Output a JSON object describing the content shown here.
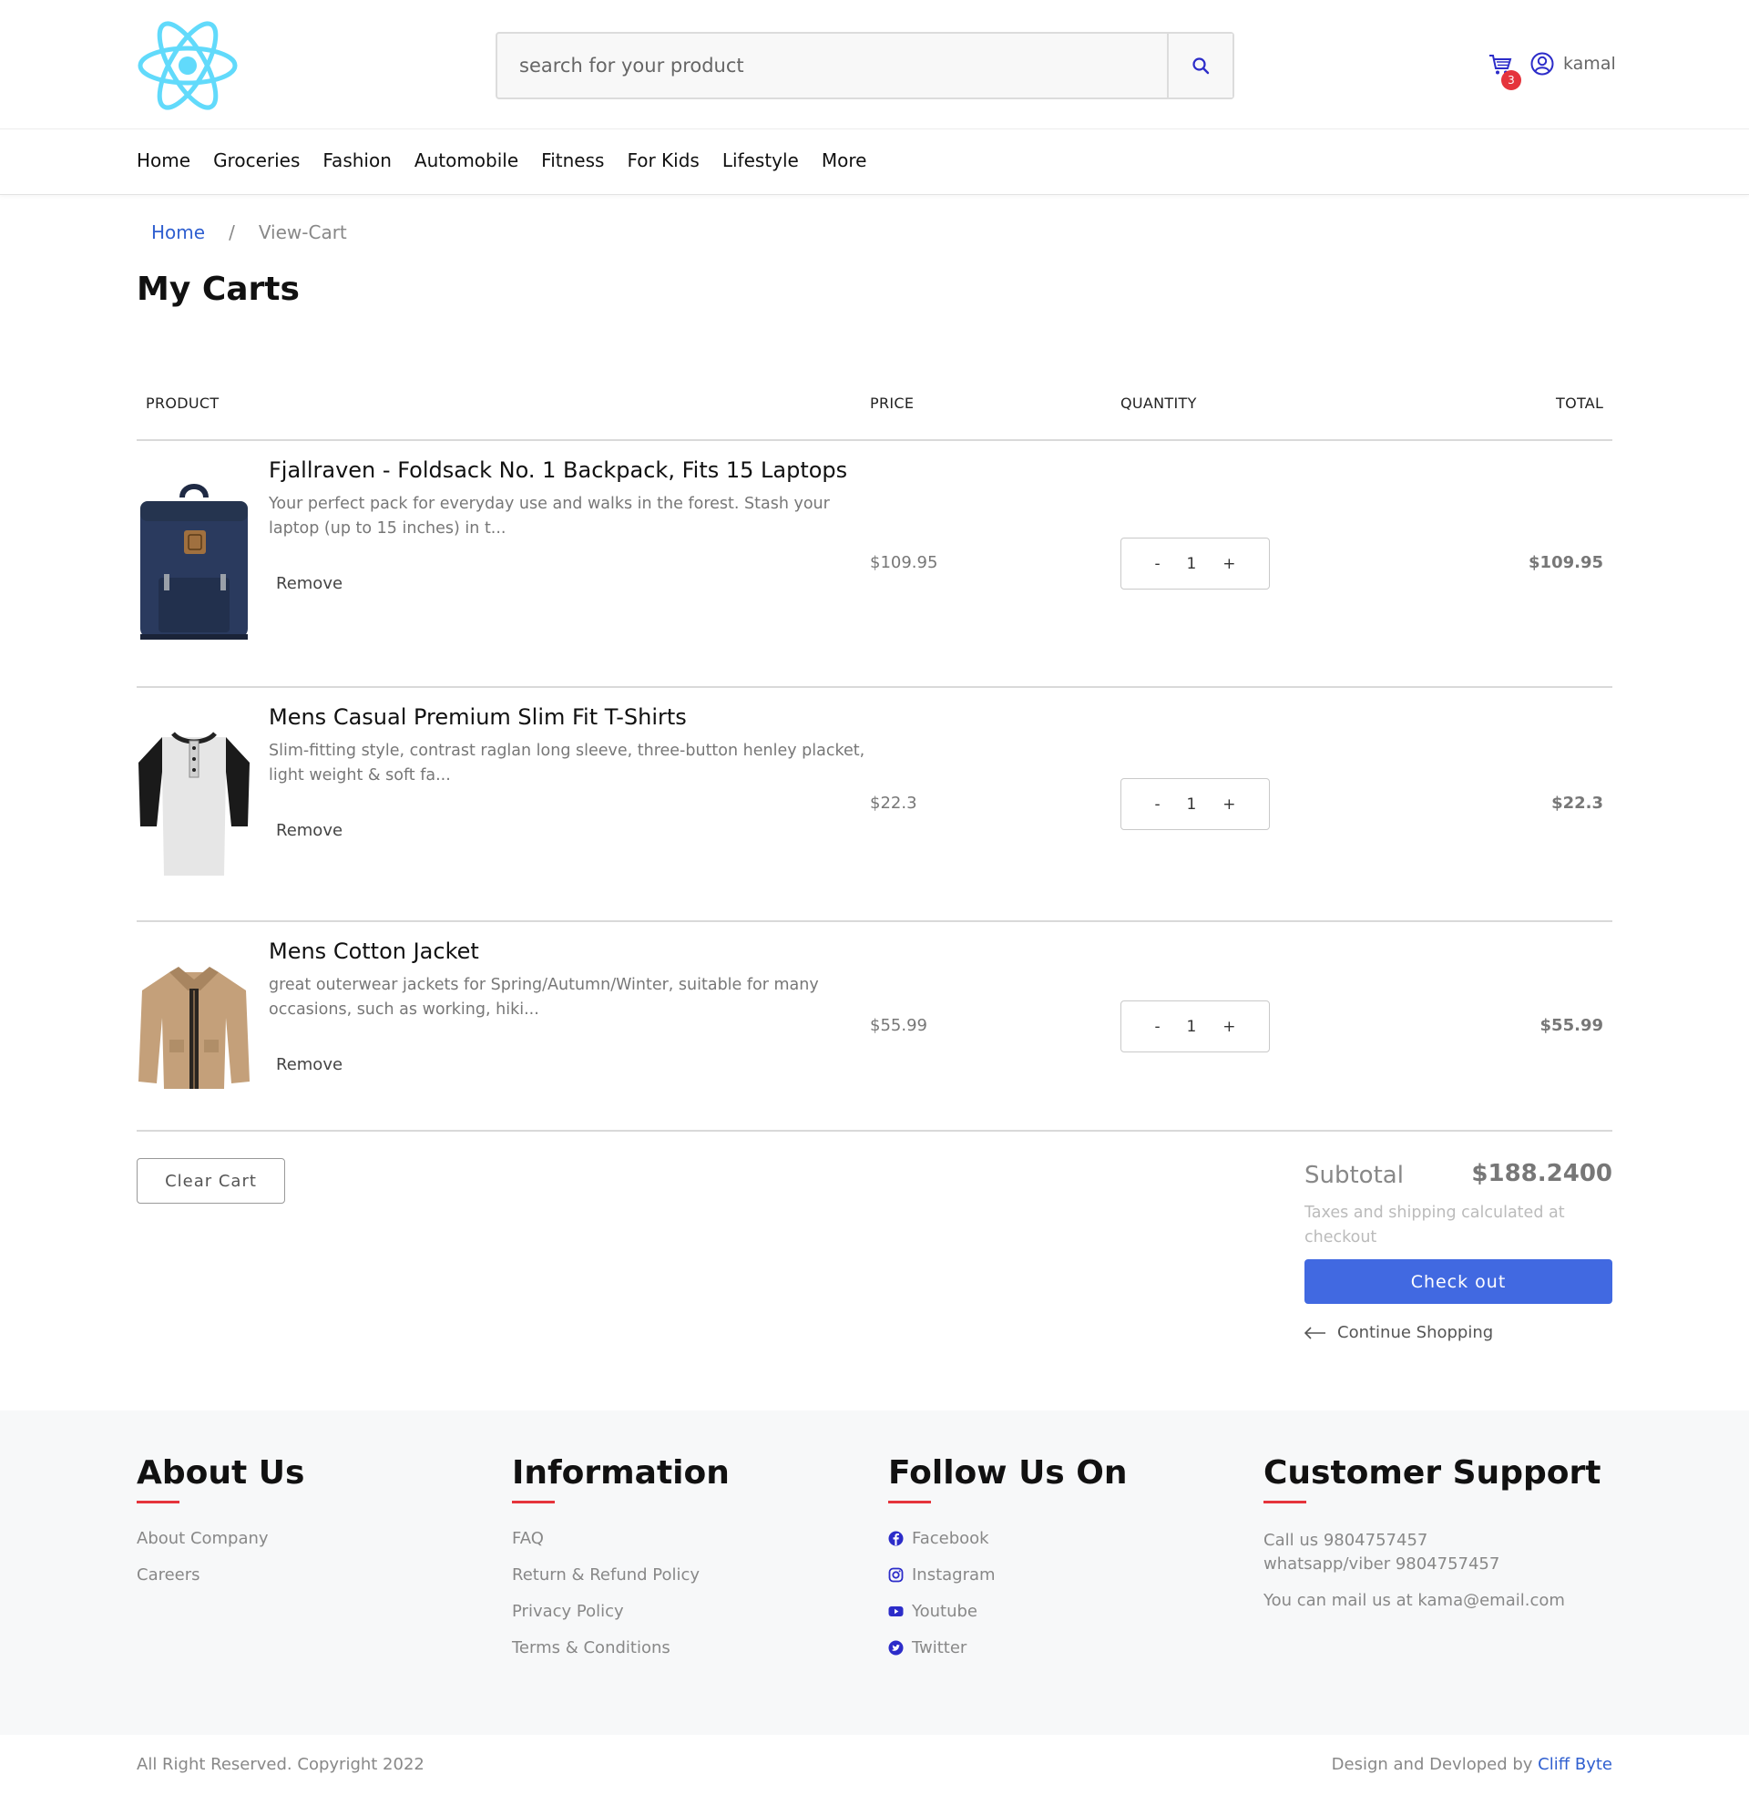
{
  "header": {
    "search_placeholder": "search for your product",
    "cart_count": "3",
    "username": "kamal",
    "logo_color": "#61dafb"
  },
  "nav": {
    "items": [
      "Home",
      "Groceries",
      "Fashion",
      "Automobile",
      "Fitness",
      "For Kids",
      "Lifestyle",
      "More"
    ]
  },
  "breadcrumb": {
    "home": "Home",
    "separator": "/",
    "current": "View-Cart"
  },
  "page_title": "My Carts",
  "table": {
    "headers": {
      "product": "PRODUCT",
      "price": "PRICE",
      "quantity": "QUANTITY",
      "total": "TOTAL"
    },
    "rows": [
      {
        "title": "Fjallraven - Foldsack No. 1 Backpack, Fits 15 Laptops",
        "description": "Your perfect pack for everyday use and walks in the forest. Stash your laptop (up to 15 inches) in t...",
        "remove": "Remove",
        "price": "$109.95",
        "qty_minus": "-",
        "qty": "1",
        "qty_plus": "+",
        "total": "$109.95",
        "image": "backpack"
      },
      {
        "title": "Mens Casual Premium Slim Fit T-Shirts",
        "description": "Slim-fitting style, contrast raglan long sleeve, three-button henley placket, light weight & soft fa...",
        "remove": "Remove",
        "price": "$22.3",
        "qty_minus": "-",
        "qty": "1",
        "qty_plus": "+",
        "total": "$22.3",
        "image": "t-shirt"
      },
      {
        "title": "Mens Cotton Jacket",
        "description": "great outerwear jackets for Spring/Autumn/Winter, suitable for many occasions, such as working, hiki...",
        "remove": "Remove",
        "price": "$55.99",
        "qty_minus": "-",
        "qty": "1",
        "qty_plus": "+",
        "total": "$55.99",
        "image": "jacket"
      }
    ]
  },
  "summary": {
    "clear_cart": "Clear Cart",
    "subtotal_label": "Subtotal",
    "subtotal_value": "$188.2400",
    "tax_note": "Taxes and shipping calculated at checkout",
    "checkout": "Check out",
    "continue": "Continue Shopping",
    "checkout_color": "#4169e1"
  },
  "footer": {
    "about": {
      "heading": "About Us",
      "links": [
        "About Company",
        "Careers"
      ]
    },
    "information": {
      "heading": "Information",
      "links": [
        "FAQ",
        "Return & Refund Policy",
        "Privacy Policy",
        "Terms & Conditions"
      ]
    },
    "follow": {
      "heading": "Follow Us On",
      "links": [
        {
          "label": "Facebook",
          "icon": "facebook-icon"
        },
        {
          "label": "Instagram",
          "icon": "instagram-icon"
        },
        {
          "label": "Youtube",
          "icon": "youtube-icon"
        },
        {
          "label": "Twitter",
          "icon": "twitter-icon"
        }
      ]
    },
    "support": {
      "heading": "Customer Support",
      "call": "Call us  9804757457",
      "whatsapp": "whatsapp/viber  9804757457",
      "mail": "You can mail us at  kama@email.com"
    },
    "accent_color": "#e5343c",
    "copyright": "All Right Reserved. Copyright 2022",
    "credit_prefix": "Design and Devloped by ",
    "credit_link": "Cliff Byte"
  }
}
